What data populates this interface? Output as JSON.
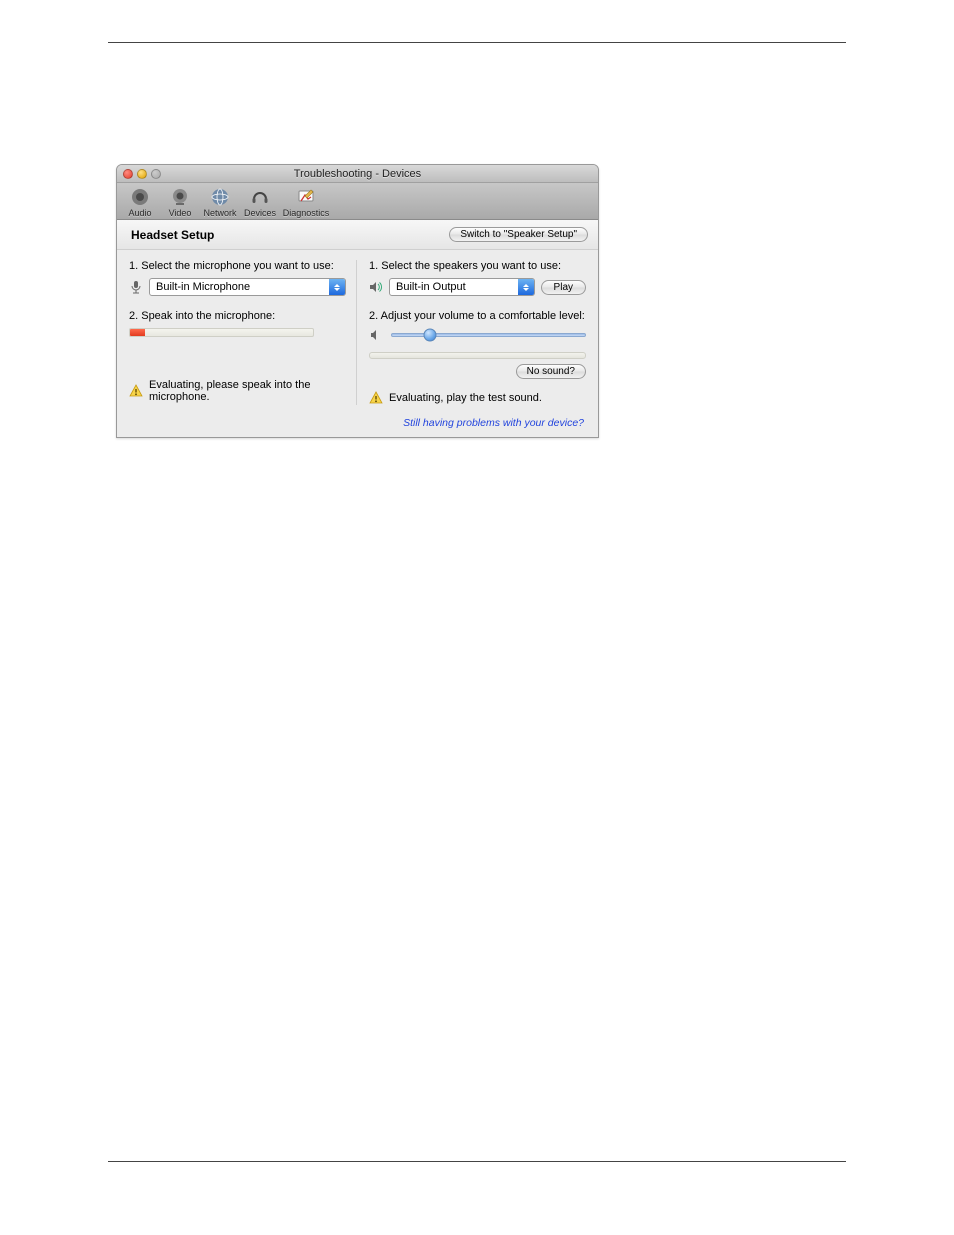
{
  "window": {
    "title": "Troubleshooting - Devices"
  },
  "toolbar": {
    "items": [
      {
        "label": "Audio"
      },
      {
        "label": "Video"
      },
      {
        "label": "Network"
      },
      {
        "label": "Devices"
      },
      {
        "label": "Diagnostics"
      }
    ]
  },
  "header": {
    "heading": "Headset Setup",
    "switch_button": "Switch to \"Speaker Setup\""
  },
  "mic": {
    "step1_label": "1. Select the microphone you want to use:",
    "selected": "Built-in Microphone",
    "step2_label": "2. Speak into the microphone:",
    "status": "Evaluating, please speak into the microphone."
  },
  "spk": {
    "step1_label": "1. Select the speakers you want to use:",
    "selected": "Built-in Output",
    "play_button": "Play",
    "step2_label": "2. Adjust your volume to a comfortable level:",
    "nosound_button": "No sound?",
    "status": "Evaluating, play the test sound."
  },
  "footer": {
    "link": "Still having problems with your device?"
  }
}
